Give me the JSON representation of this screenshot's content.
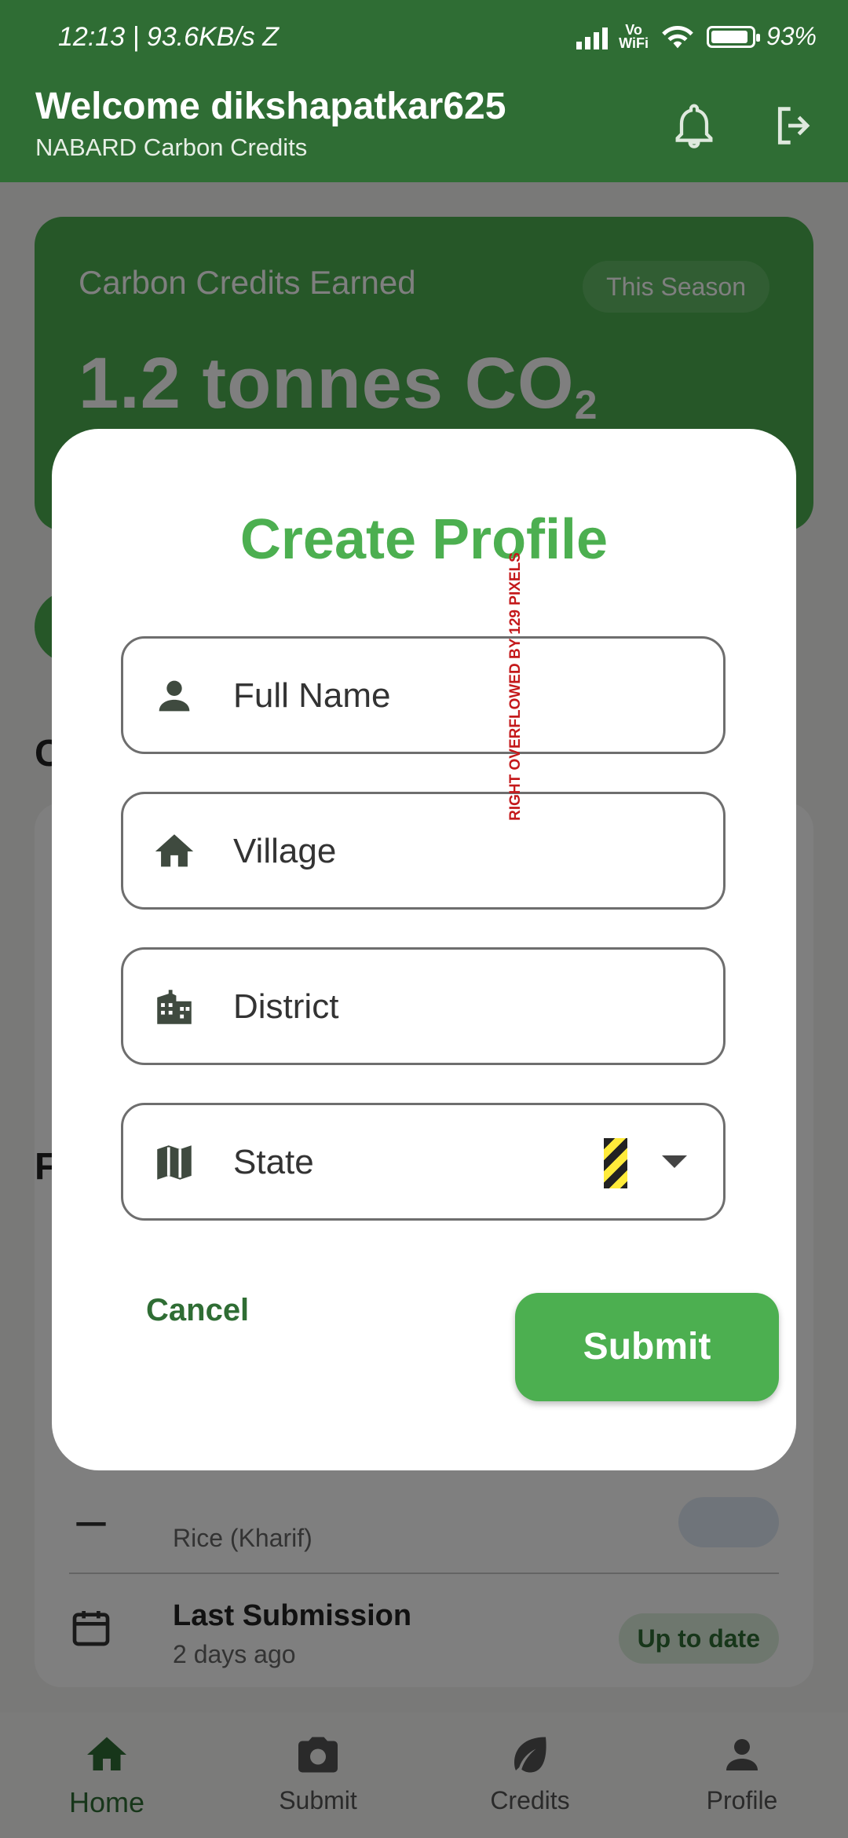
{
  "status_bar": {
    "time": "12:13",
    "network_speed": "93.6KB/s",
    "carrier_extra": "Z",
    "volte_line1": "Vo",
    "volte_line2": "WiFi",
    "battery_percent": 93,
    "battery_text": "93%"
  },
  "app_bar": {
    "title": "Welcome dikshapatkar625",
    "subtitle": "NABARD Carbon Credits",
    "icons": [
      "bell-icon",
      "logout-icon"
    ]
  },
  "credits_card": {
    "label": "Carbon Credits Earned",
    "badge": "This Season",
    "value": "1.2 tonnes CO",
    "value_subscript": "2"
  },
  "sections": {
    "section2_initial": "C",
    "section3_initial": "F"
  },
  "farm_rows": [
    {
      "title": "",
      "subtitle": "Rice (Kharif)",
      "icon": "crop-icon"
    },
    {
      "title": "Last Submission",
      "subtitle": "2 days ago",
      "badge": "Up to date",
      "icon": "calendar-icon"
    }
  ],
  "bottom_nav": [
    {
      "label": "Home",
      "icon": "home-icon",
      "active": true
    },
    {
      "label": "Submit",
      "icon": "camera-icon",
      "active": false
    },
    {
      "label": "Credits",
      "icon": "leaf-icon",
      "active": false
    },
    {
      "label": "Profile",
      "icon": "person-icon",
      "active": false
    }
  ],
  "dialog": {
    "title": "Create Profile",
    "fields": {
      "full_name": {
        "placeholder": "Full Name",
        "icon": "person-icon"
      },
      "village": {
        "placeholder": "Village",
        "icon": "home-icon"
      },
      "district": {
        "placeholder": "District",
        "icon": "building-icon"
      },
      "state": {
        "label": "State",
        "icon": "map-icon"
      }
    },
    "overflow_warning": "RIGHT OVERFLOWED BY 129 PIXELS",
    "cancel_label": "Cancel",
    "submit_label": "Submit"
  },
  "colors": {
    "primary_dark": "#2f6d34",
    "primary": "#4caf50",
    "scrim": "rgba(0,0,0,0.5)"
  }
}
